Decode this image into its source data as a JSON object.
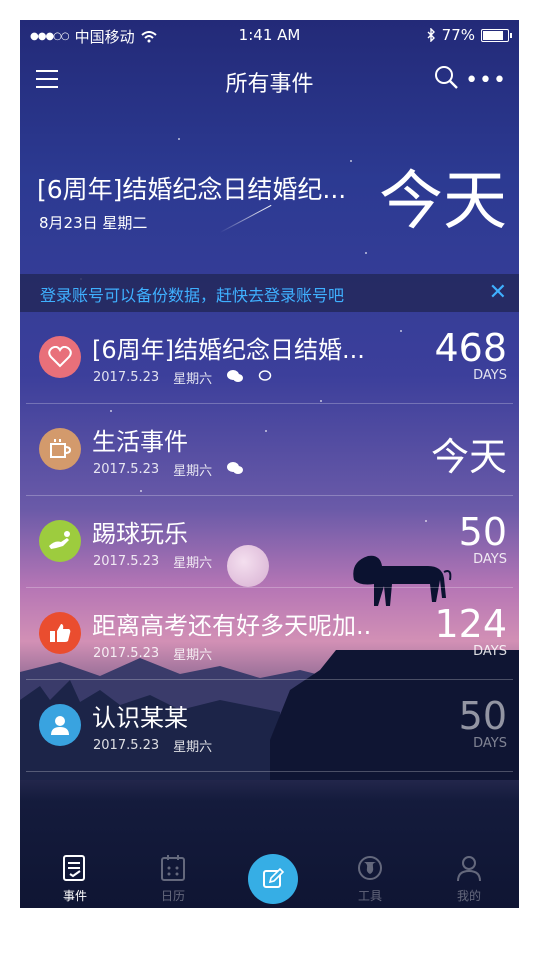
{
  "status_bar": {
    "carrier": "中国移动",
    "time": "1:41 AM",
    "battery": "77%",
    "battery_level": 0.77
  },
  "nav": {
    "title": "所有事件",
    "icons": [
      "menu-icon",
      "search-icon",
      "more-icon"
    ]
  },
  "hero": {
    "name": "[6周年]结婚纪念日结婚纪...",
    "date": "8月23日 星期二",
    "countdown": "今天"
  },
  "banner": {
    "text": "登录账号可以备份数据，赶快去登录账号吧",
    "close": "✕"
  },
  "events": [
    {
      "title": "[6周年]结婚纪念日结婚...",
      "date": "2017.5.23",
      "weekday": "星期六",
      "count": "468",
      "unit": "DAYS",
      "icon": "heart-icon",
      "color": "#e8707a"
    },
    {
      "title": "生活事件",
      "date": "2017.5.23",
      "weekday": "星期六",
      "count": "今天",
      "unit": "",
      "icon": "cup-icon",
      "color": "#d39a6c"
    },
    {
      "title": "踢球玩乐",
      "date": "2017.5.23",
      "weekday": "星期六",
      "count": "50",
      "unit": "DAYS",
      "icon": "kick-icon",
      "color": "#9dcc3e"
    },
    {
      "title": "距离高考还有好多天呢加..",
      "date": "2017.5.23",
      "weekday": "星期六",
      "count": "124",
      "unit": "DAYS",
      "icon": "thumbs-up-icon",
      "color": "#ea4d2f"
    },
    {
      "title": "认识某某",
      "date": "2017.5.23",
      "weekday": "星期六",
      "count": "50",
      "unit": "DAYS",
      "icon": "person-icon",
      "color": "#39a3e0"
    }
  ],
  "tabs": [
    {
      "label": "事件",
      "icon": "event-list-icon"
    },
    {
      "label": "日历",
      "icon": "calendar-icon"
    },
    {
      "label": "",
      "icon": "edit-icon"
    },
    {
      "label": "工具",
      "icon": "globe-icon"
    },
    {
      "label": "我的",
      "icon": "profile-icon"
    }
  ]
}
